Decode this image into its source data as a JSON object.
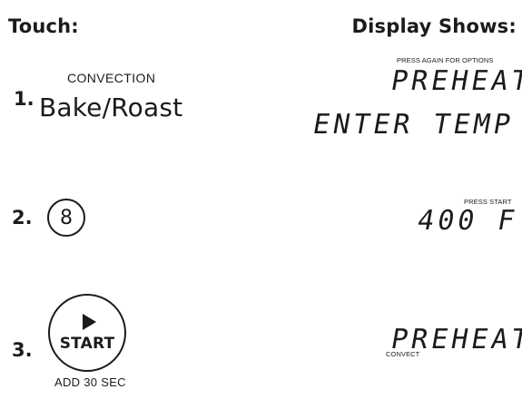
{
  "headers": {
    "touch": "Touch:",
    "display": "Display Shows:"
  },
  "steps": [
    {
      "number": "1.",
      "touch_small_label": "CONVECTION",
      "touch_main_label": "Bake/Roast",
      "display_hint": "PRESS AGAIN FOR OPTIONS",
      "display_lines": [
        "PREHEAT",
        "ENTER TEMP"
      ]
    },
    {
      "number": "2.",
      "touch_key": "8",
      "display_hint": "PRESS START",
      "display_lines": [
        "400 F"
      ]
    },
    {
      "number": "3.",
      "touch_key": "START",
      "touch_below_label": "ADD 30 SEC",
      "display_lines": [
        "PREHEAT"
      ],
      "display_sub_label": "CONVECT"
    }
  ]
}
